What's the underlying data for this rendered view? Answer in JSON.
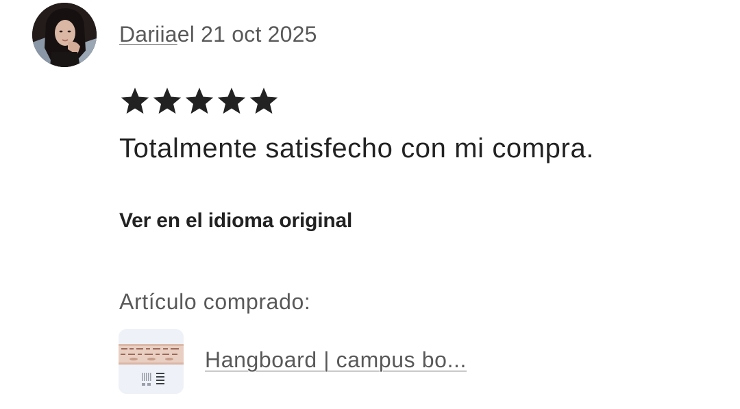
{
  "review": {
    "reviewer_name": "Dariia",
    "date_text": "el 21 oct 2025",
    "rating": 5,
    "rating_max": 5,
    "text": "Totalmente satisfecho con mi compra.",
    "translate_link": "Ver en el idioma original"
  },
  "purchased": {
    "label": "Artículo comprado:",
    "item_title": "Hangboard | campus bo...",
    "thumbnail_icon": "hangboard-product-thumbnail"
  },
  "icons": {
    "avatar": "reviewer-avatar-photo",
    "star": "star-icon"
  },
  "colors": {
    "text_primary": "#222222",
    "text_secondary": "#595959",
    "star": "#222222",
    "background": "#ffffff"
  }
}
